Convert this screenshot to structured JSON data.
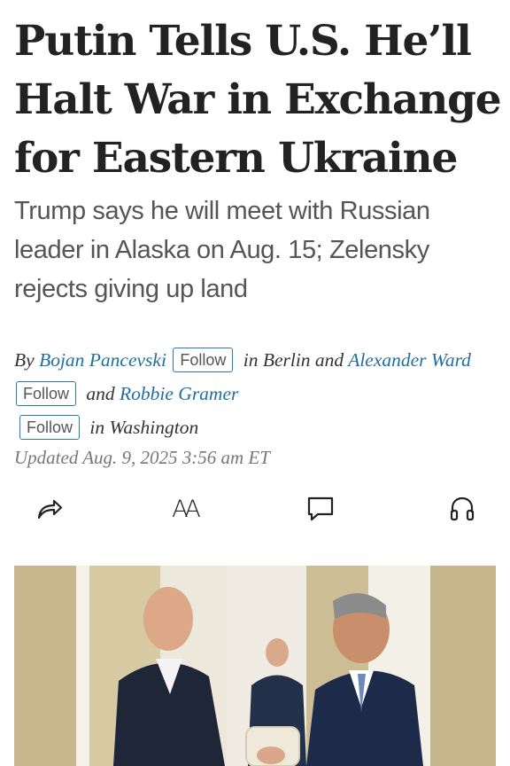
{
  "article": {
    "headline": "Putin Tells U.S. He’ll Halt War in Exchange for Eastern Ukraine",
    "dek": "Trump says he will meet with Russian leader in Alaska on Aug. 15; Zelensky rejects giving up land",
    "byline": {
      "by": "By",
      "authors": [
        {
          "name": "Bojan Pancevski",
          "follow_label": "Follow"
        },
        {
          "name": "Alexander Ward",
          "follow_label": "Follow"
        },
        {
          "name": "Robbie Gramer",
          "follow_label": "Follow"
        }
      ],
      "location_1": "in Berlin and",
      "connector": "and",
      "location_2": "in Washington"
    },
    "updated": "Updated Aug. 9, 2025 3:56 am ET"
  },
  "toolbar": {
    "share_icon": "share-arrow-icon",
    "text_size_label": "AA",
    "text_size_icon": "text-size-icon",
    "comments_icon": "comment-bubble-icon",
    "listen_icon": "headphones-icon"
  },
  "colors": {
    "headline": "#222222",
    "dek": "#555555",
    "author_link": "#1e6fa0",
    "follow_border": "#2a7ab0",
    "updated": "#777777"
  }
}
